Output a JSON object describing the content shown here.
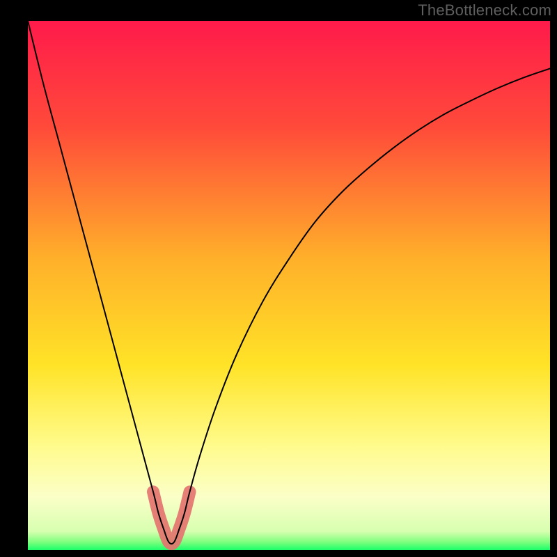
{
  "watermark": "TheBottleneck.com",
  "chart_data": {
    "type": "line",
    "title": "",
    "xlabel": "",
    "ylabel": "",
    "xlim": [
      0,
      100
    ],
    "ylim": [
      0,
      100
    ],
    "optimum_x": 27.5,
    "series": [
      {
        "name": "bottleneck-curve",
        "x": [
          0,
          3,
          6,
          9,
          12,
          15,
          18,
          21,
          24,
          25,
          26,
          27,
          28,
          29,
          30,
          31,
          33,
          36,
          40,
          45,
          50,
          55,
          60,
          65,
          70,
          75,
          80,
          85,
          90,
          95,
          100
        ],
        "y": [
          100,
          88,
          77,
          66,
          55,
          44,
          33,
          22,
          11,
          7,
          4,
          1.5,
          1.5,
          4,
          7,
          11,
          18,
          27,
          37,
          47,
          55,
          62,
          67.5,
          72,
          76,
          79.5,
          82.5,
          85,
          87.3,
          89.3,
          91
        ]
      },
      {
        "name": "highlight-band",
        "x": [
          24,
          25,
          26,
          27,
          28,
          29,
          30,
          31
        ],
        "y": [
          11,
          7,
          4,
          1.5,
          1.5,
          4,
          7,
          11
        ]
      }
    ],
    "gradient_stops": [
      {
        "offset": 0,
        "color": "#ff1a4b"
      },
      {
        "offset": 0.2,
        "color": "#ff4a3a"
      },
      {
        "offset": 0.45,
        "color": "#ffb02a"
      },
      {
        "offset": 0.65,
        "color": "#ffe327"
      },
      {
        "offset": 0.8,
        "color": "#fffb8a"
      },
      {
        "offset": 0.9,
        "color": "#fbffc8"
      },
      {
        "offset": 0.965,
        "color": "#d7ffb0"
      },
      {
        "offset": 0.985,
        "color": "#7dff7d"
      },
      {
        "offset": 1.0,
        "color": "#1aff6a"
      }
    ],
    "highlight_color": "#e4746f",
    "curve_color": "#000000"
  }
}
